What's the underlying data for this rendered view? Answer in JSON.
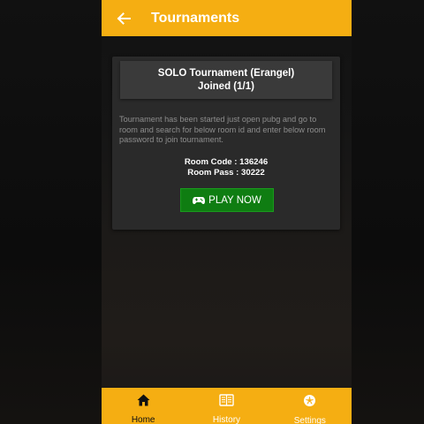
{
  "app_bar": {
    "title": "Tournaments",
    "back_icon": "arrow-left-icon",
    "background": "#f5ae12"
  },
  "card": {
    "title_line1": "SOLO Tournament (Erangel)",
    "title_line2": "Joined (1/1)",
    "description": "Tournament has been started just open pubg and go to room and search for below room id and enter below room password to join tournament.",
    "room_code": "Room Code : 136246",
    "room_pass": "Room Pass : 30222",
    "play_button_label": "PLAY NOW",
    "play_button_icon": "gamepad-icon",
    "play_button_color": "#0f7d12"
  },
  "bottom_nav": {
    "items": [
      {
        "label": "Home",
        "icon": "home-icon",
        "active": true
      },
      {
        "label": "History",
        "icon": "history-icon",
        "active": false
      },
      {
        "label": "Settings",
        "icon": "settings-icon",
        "active": false
      }
    ]
  }
}
